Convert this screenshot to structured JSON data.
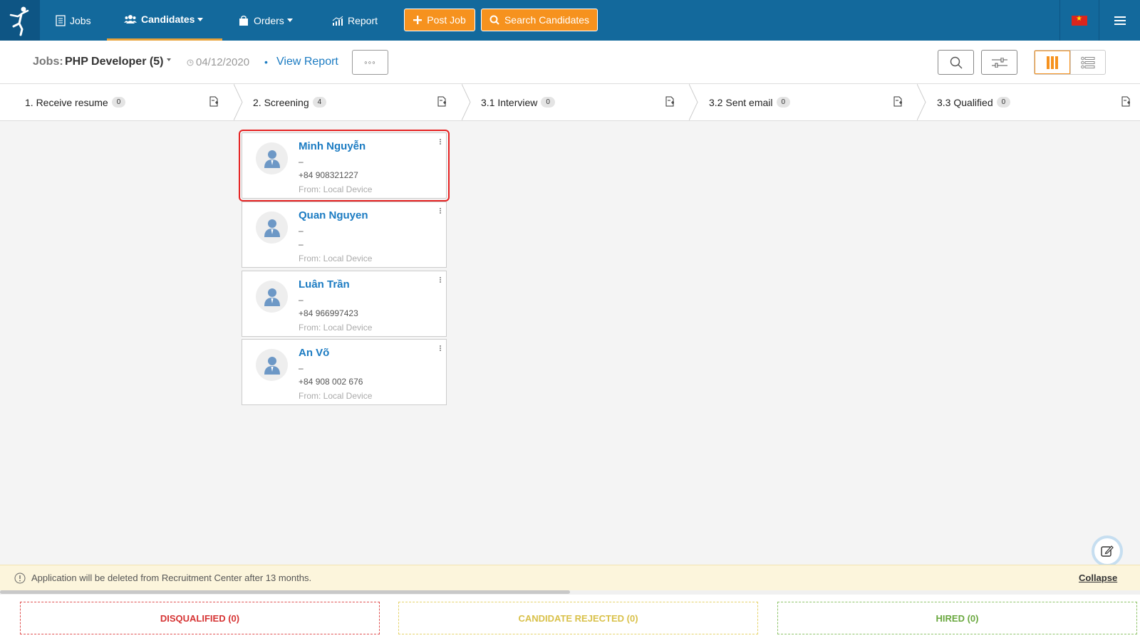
{
  "nav": {
    "jobs": "Jobs",
    "candidates": "Candidates",
    "orders": "Orders",
    "report": "Report",
    "post_job": "Post Job",
    "search_candidates": "Search Candidates"
  },
  "header": {
    "jobs_label": "Jobs:",
    "job_title": "PHP Developer (5)",
    "date": "04/12/2020",
    "separator": "•",
    "view_report": "View Report",
    "more": "◦◦◦"
  },
  "stages": [
    {
      "label": "1. Receive resume",
      "count": "0"
    },
    {
      "label": "2. Screening",
      "count": "4"
    },
    {
      "label": "3.1 Interview",
      "count": "0"
    },
    {
      "label": "3.2 Sent email",
      "count": "0"
    },
    {
      "label": "3.3 Qualified",
      "count": "0"
    }
  ],
  "candidates": [
    {
      "name": "Minh Nguyễn",
      "line1": "–",
      "line2": "+84 908321227",
      "source": "From: Local Device"
    },
    {
      "name": "Quan Nguyen",
      "line1": "–",
      "line2": "–",
      "source": "From: Local Device"
    },
    {
      "name": "Luân Trần",
      "line1": "–",
      "line2": "+84 966997423",
      "source": "From: Local Device"
    },
    {
      "name": "An Võ",
      "line1": "–",
      "line2": "+84 908 002 676",
      "source": "From: Local Device"
    }
  ],
  "notice": {
    "text": "Application will be deleted from Recruitment Center after 13 months.",
    "collapse": "Collapse"
  },
  "zones": {
    "disqualified": "DISQUALIFIED (0)",
    "rejected": "CANDIDATE REJECTED (0)",
    "hired": "HIRED (0)"
  },
  "colors": {
    "nav_bg": "#13699c",
    "accent": "#f6921e",
    "link": "#1b7bc2",
    "highlight": "#e62222"
  }
}
